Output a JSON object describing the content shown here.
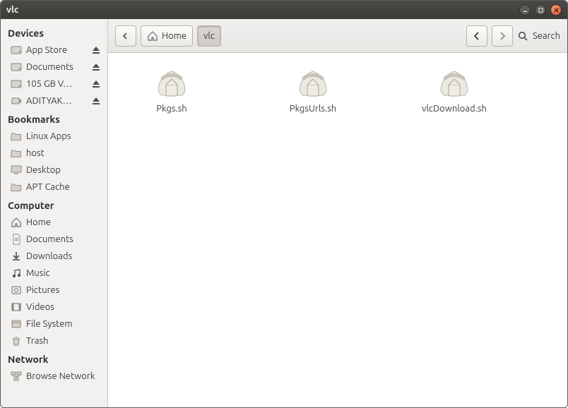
{
  "window": {
    "title": "vlc"
  },
  "toolbar": {
    "back_icon": "back",
    "crumb_home": "Home",
    "crumb_current": "vlc",
    "search_label": "Search"
  },
  "sidebar": {
    "devices_heading": "Devices",
    "devices": [
      {
        "label": "App Store",
        "icon": "drive",
        "eject": true
      },
      {
        "label": "Documents",
        "icon": "drive",
        "eject": true
      },
      {
        "label": "105 GB V…",
        "icon": "drive",
        "eject": true
      },
      {
        "label": "ADITYAK…",
        "icon": "usb",
        "eject": true
      }
    ],
    "bookmarks_heading": "Bookmarks",
    "bookmarks": [
      {
        "label": "Linux Apps",
        "icon": "folder"
      },
      {
        "label": "host",
        "icon": "folder"
      },
      {
        "label": "Desktop",
        "icon": "desktop"
      },
      {
        "label": "APT Cache",
        "icon": "folder"
      }
    ],
    "computer_heading": "Computer",
    "computer": [
      {
        "label": "Home",
        "icon": "home"
      },
      {
        "label": "Documents",
        "icon": "documents"
      },
      {
        "label": "Downloads",
        "icon": "downloads"
      },
      {
        "label": "Music",
        "icon": "music"
      },
      {
        "label": "Pictures",
        "icon": "pictures"
      },
      {
        "label": "Videos",
        "icon": "videos"
      },
      {
        "label": "File System",
        "icon": "filesystem"
      },
      {
        "label": "Trash",
        "icon": "trash"
      }
    ],
    "network_heading": "Network",
    "network": [
      {
        "label": "Browse Network",
        "icon": "network"
      }
    ]
  },
  "files": [
    {
      "name": "Pkgs.sh"
    },
    {
      "name": "PkgsUrls.sh"
    },
    {
      "name": "vlcDownload.sh"
    }
  ]
}
